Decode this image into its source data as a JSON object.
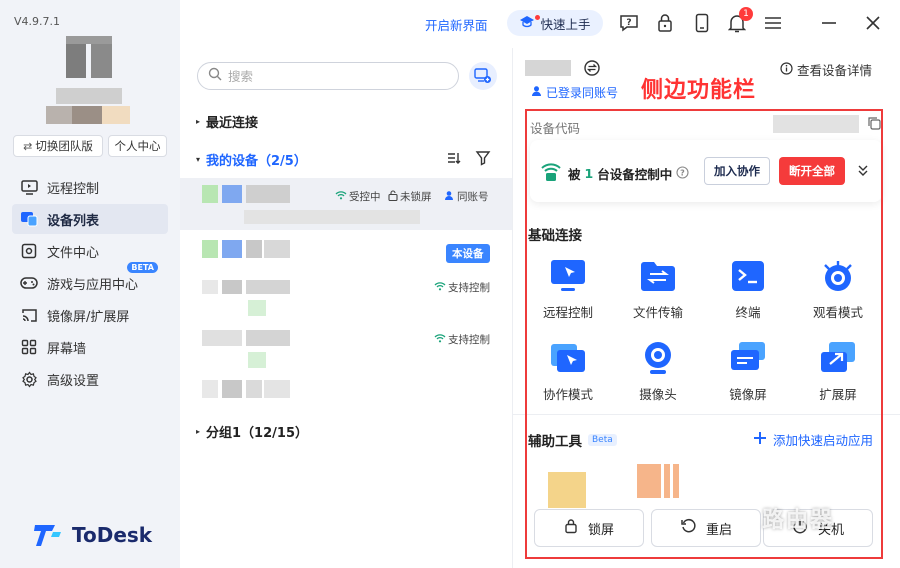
{
  "app": {
    "version": "V4.9.7.1",
    "brand": "ToDesk",
    "accent": "#1f66ff",
    "danger": "#f53b3b"
  },
  "sidebar": {
    "team_btn": "切换团队版",
    "user_btn": "个人中心",
    "items": [
      {
        "label": "远程控制",
        "icon": "remote-icon",
        "active": false
      },
      {
        "label": "设备列表",
        "icon": "device-list-icon",
        "active": true
      },
      {
        "label": "文件中心",
        "icon": "file-center-icon",
        "active": false
      },
      {
        "label": "游戏与应用中心",
        "icon": "gamepad-icon",
        "active": false,
        "badge": "BETA"
      },
      {
        "label": "镜像屏/扩展屏",
        "icon": "cast-icon",
        "active": false
      },
      {
        "label": "屏幕墙",
        "icon": "grid-icon",
        "active": false
      },
      {
        "label": "高级设置",
        "icon": "gear-icon",
        "active": false
      }
    ]
  },
  "topbar": {
    "new_ui": "开启新界面",
    "quick_start": "快速上手",
    "notification_count": "1"
  },
  "devices": {
    "search_placeholder": "搜索",
    "recent": "最近连接",
    "mine": "我的设备（2/5）",
    "group1": "分组1（12/15）",
    "status_controlled": "受控中",
    "status_unlocked": "未锁屏",
    "status_same_account": "同账号",
    "this_device": "本设备",
    "support_control": "支持控制"
  },
  "panel": {
    "detail": "查看设备详情",
    "same_account": "已登录同账号",
    "annotation": "侧边功能栏",
    "code_label": "设备代码",
    "controlled_prefix": "被",
    "controlled_count": "1",
    "controlled_suffix": "台设备控制中",
    "join": "加入协作",
    "disconnect_all": "断开全部",
    "basic_title": "基础连接",
    "functions": [
      {
        "label": "远程控制",
        "icon": "remote-control-icon"
      },
      {
        "label": "文件传输",
        "icon": "file-transfer-icon"
      },
      {
        "label": "终端",
        "icon": "terminal-icon"
      },
      {
        "label": "观看模式",
        "icon": "eye-icon"
      },
      {
        "label": "协作模式",
        "icon": "collab-icon"
      },
      {
        "label": "摄像头",
        "icon": "camera-icon"
      },
      {
        "label": "镜像屏",
        "icon": "mirror-icon"
      },
      {
        "label": "扩展屏",
        "icon": "extend-icon"
      }
    ],
    "aux_title": "辅助工具",
    "beta": "Beta",
    "add_app": "添加快速启动应用",
    "lock": "锁屏",
    "restart": "重启",
    "shutdown": "关机"
  },
  "watermark": "路由器"
}
